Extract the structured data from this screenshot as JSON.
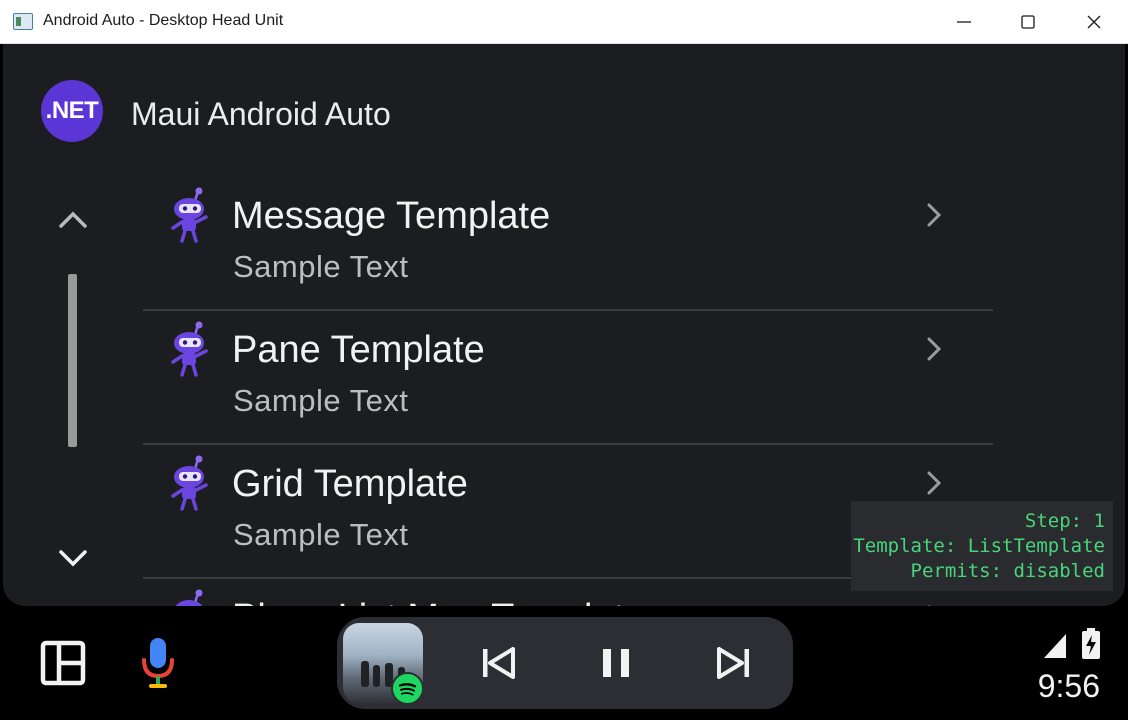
{
  "window": {
    "title": "Android Auto - Desktop Head Unit",
    "icons": {
      "app": "window-app-icon",
      "minimize": "minimize-icon",
      "maximize": "maximize-icon",
      "close": "close-icon"
    }
  },
  "header": {
    "logo_text": ".NET",
    "app_title": "Maui Android Auto",
    "logo_color": "#5b35d5"
  },
  "list": {
    "items": [
      {
        "title": "Message Template",
        "subtitle": "Sample Text",
        "icon": "dotnet-bot-icon"
      },
      {
        "title": "Pane Template",
        "subtitle": "Sample Text",
        "icon": "dotnet-bot-icon"
      },
      {
        "title": "Grid Template",
        "subtitle": "Sample Text",
        "icon": "dotnet-bot-icon"
      },
      {
        "title": "Place List Map Template",
        "subtitle": "",
        "icon": "dotnet-bot-icon"
      }
    ]
  },
  "scroll": {
    "up_icon": "chevron-up-icon",
    "down_icon": "chevron-down-icon"
  },
  "debug": {
    "step": "Step: 1",
    "template": "Template: ListTemplate",
    "permits": "Permits: disabled",
    "text_color": "#49d47a"
  },
  "rail": {
    "dashboard_icon": "dashboard-layout-icon",
    "mic_icon": "microphone-icon",
    "media": {
      "source_icon": "spotify-icon",
      "prev_icon": "skip-previous-icon",
      "pause_icon": "pause-icon",
      "next_icon": "skip-next-icon"
    },
    "signal_icon": "signal-icon",
    "battery_icon": "battery-charging-icon",
    "clock": "9:56"
  }
}
